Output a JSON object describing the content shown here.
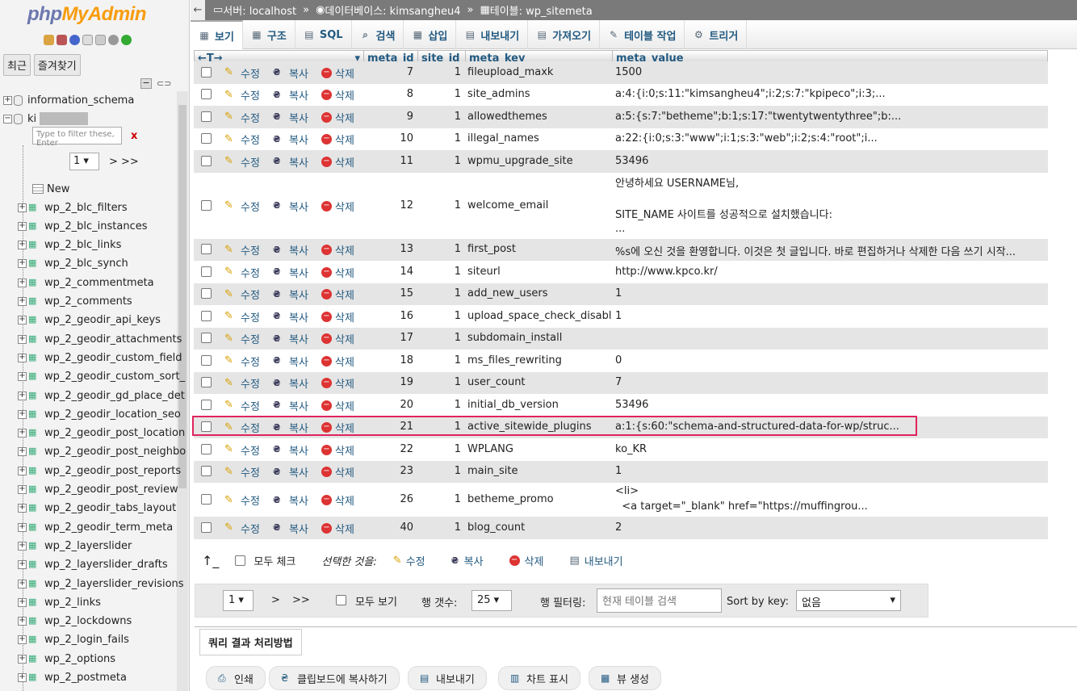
{
  "logo": {
    "php": "php",
    "my": "MyAdmin"
  },
  "nav": {
    "tab_recent": "최근",
    "tab_favorites": "즐겨찾기",
    "databases": [
      {
        "name": "information_schema"
      },
      {
        "name": "ki"
      }
    ],
    "filter_placeholder": "Type to filter these, Enter",
    "filter_clear": "x",
    "page_select": "1",
    "page_next": "> >>",
    "new_label": "New",
    "tables": [
      "wp_2_blc_filters",
      "wp_2_blc_instances",
      "wp_2_blc_links",
      "wp_2_blc_synch",
      "wp_2_commentmeta",
      "wp_2_comments",
      "wp_2_geodir_api_keys",
      "wp_2_geodir_attachments",
      "wp_2_geodir_custom_field",
      "wp_2_geodir_custom_sort_",
      "wp_2_geodir_gd_place_det",
      "wp_2_geodir_location_seo",
      "wp_2_geodir_post_location",
      "wp_2_geodir_post_neighbo",
      "wp_2_geodir_post_reports",
      "wp_2_geodir_post_review",
      "wp_2_geodir_tabs_layout",
      "wp_2_geodir_term_meta",
      "wp_2_layerslider",
      "wp_2_layerslider_drafts",
      "wp_2_layerslider_revisions",
      "wp_2_links",
      "wp_2_lockdowns",
      "wp_2_login_fails",
      "wp_2_options",
      "wp_2_postmeta"
    ]
  },
  "breadcrumb": {
    "back": "←",
    "server": "서버: localhost",
    "sep": "»",
    "database": "데이터베이스: kimsangheu4",
    "table": "테이블: wp_sitemeta"
  },
  "tabs": [
    "보기",
    "구조",
    "SQL",
    "검색",
    "삽입",
    "내보내기",
    "가져오기",
    "테이블 작업",
    "트리거"
  ],
  "tab_icons": [
    "▦",
    "▦",
    "▤",
    "⌕",
    "▦",
    "▤",
    "▤",
    "✎",
    "⚙"
  ],
  "columns": {
    "arrows": "←T→",
    "meta_id": "meta_id",
    "site_id": "site_id",
    "meta_key": "meta_key",
    "meta_value": "meta_value"
  },
  "actions": {
    "edit": "수정",
    "copy": "복사",
    "delete": "삭제"
  },
  "rows": [
    {
      "meta_id": "7",
      "site_id": "1",
      "meta_key": "fileupload_maxk",
      "meta_value": "1500"
    },
    {
      "meta_id": "8",
      "site_id": "1",
      "meta_key": "site_admins",
      "meta_value": "a:4:{i:0;s:11:\"kimsangheu4\";i:2;s:7:\"kpipeco\";i:3;..."
    },
    {
      "meta_id": "9",
      "site_id": "1",
      "meta_key": "allowedthemes",
      "meta_value": "a:5:{s:7:\"betheme\";b:1;s:17:\"twentytwentythree\";b:..."
    },
    {
      "meta_id": "10",
      "site_id": "1",
      "meta_key": "illegal_names",
      "meta_value": "a:22:{i:0;s:3:\"www\";i:1;s:3:\"web\";i:2;s:4:\"root\";i..."
    },
    {
      "meta_id": "11",
      "site_id": "1",
      "meta_key": "wpmu_upgrade_site",
      "meta_value": "53496"
    },
    {
      "meta_id": "12",
      "site_id": "1",
      "meta_key": "welcome_email",
      "meta_value": "안녕하세요 USERNAME님,",
      "meta_value_2": "SITE_NAME 사이트를 성공적으로 설치했습니다:",
      "meta_value_3": "..."
    },
    {
      "meta_id": "13",
      "site_id": "1",
      "meta_key": "first_post",
      "meta_value": "%s에 오신 것을 환영합니다. 이것은 첫 글입니다. 바로 편집하거나 삭제한 다음 쓰기 시작..."
    },
    {
      "meta_id": "14",
      "site_id": "1",
      "meta_key": "siteurl",
      "meta_value": "http://www.kpco.kr/"
    },
    {
      "meta_id": "15",
      "site_id": "1",
      "meta_key": "add_new_users",
      "meta_value": "1"
    },
    {
      "meta_id": "16",
      "site_id": "1",
      "meta_key": "upload_space_check_disabled",
      "meta_value": "1"
    },
    {
      "meta_id": "17",
      "site_id": "1",
      "meta_key": "subdomain_install",
      "meta_value": ""
    },
    {
      "meta_id": "18",
      "site_id": "1",
      "meta_key": "ms_files_rewriting",
      "meta_value": "0"
    },
    {
      "meta_id": "19",
      "site_id": "1",
      "meta_key": "user_count",
      "meta_value": "7"
    },
    {
      "meta_id": "20",
      "site_id": "1",
      "meta_key": "initial_db_version",
      "meta_value": "53496"
    },
    {
      "meta_id": "21",
      "site_id": "1",
      "meta_key": "active_sitewide_plugins",
      "meta_value": "a:1:{s:60:\"schema-and-structured-data-for-wp/struc..."
    },
    {
      "meta_id": "22",
      "site_id": "1",
      "meta_key": "WPLANG",
      "meta_value": "ko_KR"
    },
    {
      "meta_id": "23",
      "site_id": "1",
      "meta_key": "main_site",
      "meta_value": "1"
    },
    {
      "meta_id": "26",
      "site_id": "1",
      "meta_key": "betheme_promo",
      "meta_value": "<li>",
      "meta_value_2": "  <a target=\"_blank\" href=\"https://muffingrou..."
    },
    {
      "meta_id": "40",
      "site_id": "1",
      "meta_key": "blog_count",
      "meta_value": "2"
    }
  ],
  "bulk": {
    "check_all": "모두 체크",
    "with_selected": "선택한 것을:",
    "edit": "수정",
    "copy": "복사",
    "delete": "삭제",
    "export": "내보내기"
  },
  "pager": {
    "page": "1",
    "next": ">",
    "last": ">>",
    "show_all": "모두 보기",
    "rows_label": "행 갯수:",
    "rows_value": "25",
    "filter_label": "행 필터링:",
    "filter_placeholder": "현재 테이블 검색",
    "sort_label": "Sort by key:",
    "sort_value": "없음"
  },
  "query_ops": {
    "legend": "쿼리 결과 처리방법",
    "buttons": [
      "인쇄",
      "클립보드에 복사하기",
      "내보내기",
      "차트 표시",
      "뷰 생성"
    ]
  }
}
